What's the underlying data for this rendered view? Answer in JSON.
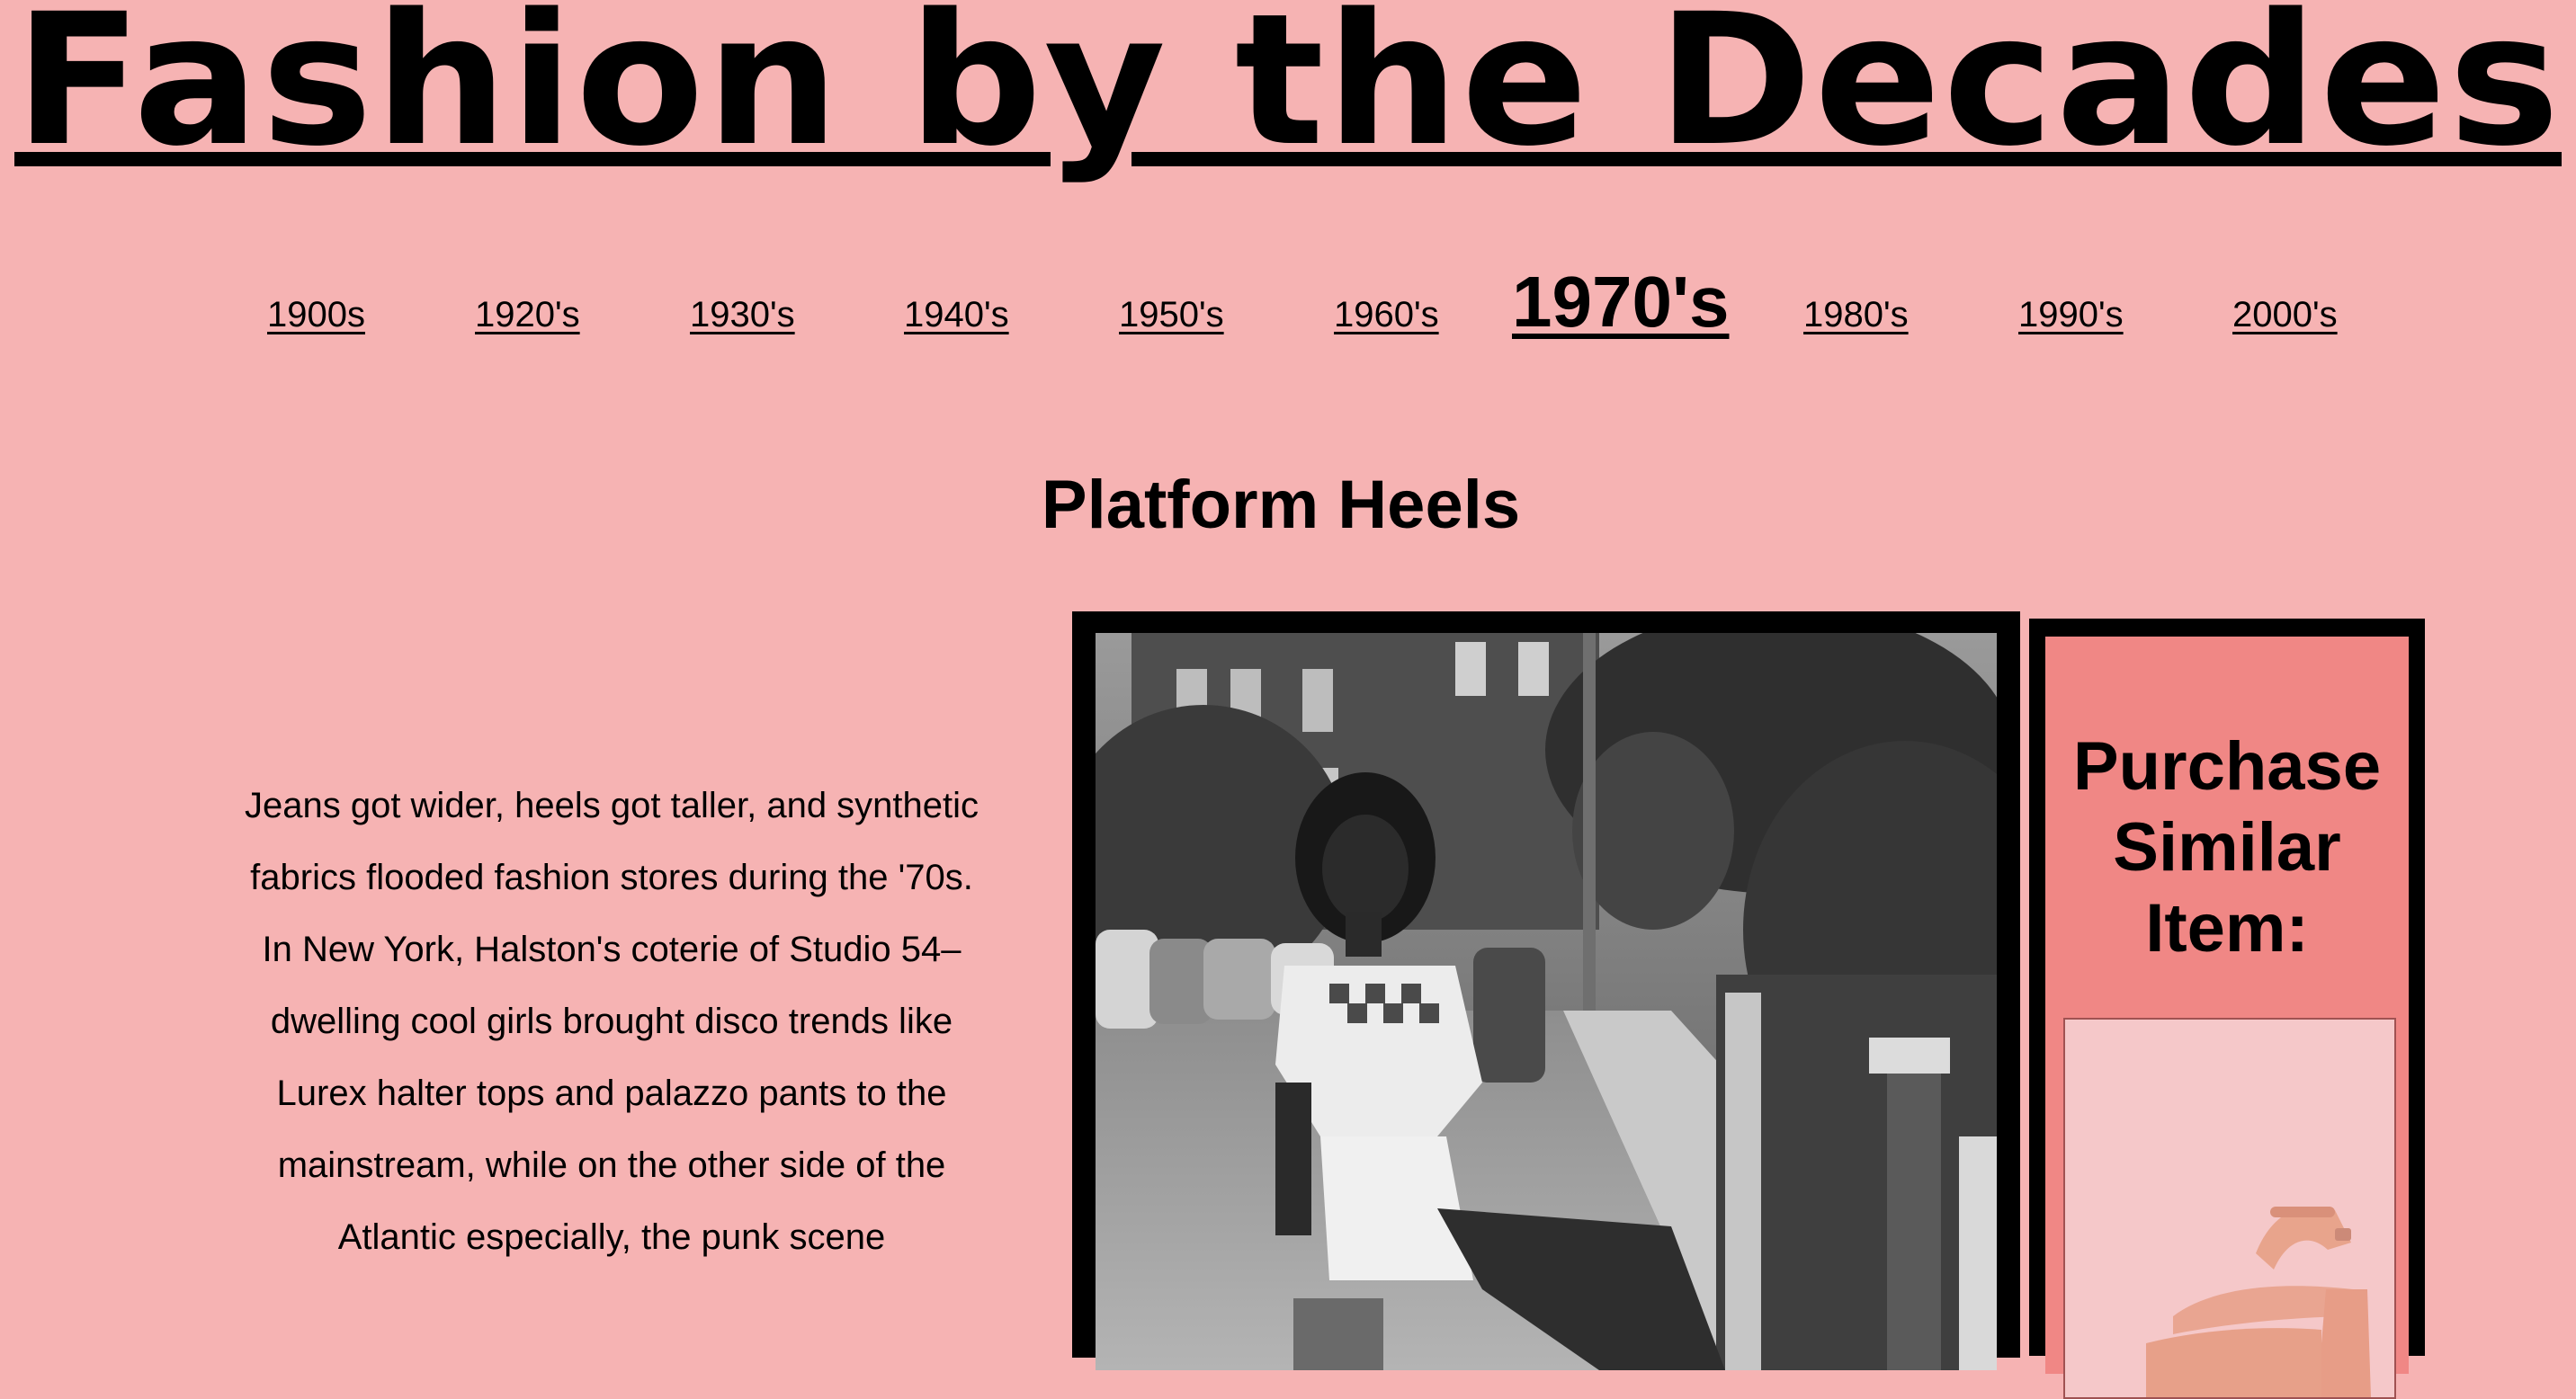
{
  "site_title": "Fashion by the Decades",
  "nav": {
    "decades": [
      "1900s",
      "1920's",
      "1930's",
      "1940's",
      "1950's",
      "1960's",
      "1970's",
      "1980's",
      "1990's",
      "2000's"
    ],
    "active": "1970's"
  },
  "section": {
    "heading": "Platform Heels",
    "description": "Jeans got wider, heels got taller, and synthetic fabrics flooded fashion stores during the '70s. In New York, Halston's coterie of Studio 54–dwelling cool girls brought disco trends like Lurex halter tops and palazzo pants to the mainstream, while on the other side of the Atlantic especially, the punk scene"
  },
  "purchase": {
    "heading": "Purchase Similar Item:"
  },
  "colors": {
    "page_background": "#f6b3b3",
    "purchase_panel": "#f08785",
    "product_background": "#f5c8c9"
  }
}
